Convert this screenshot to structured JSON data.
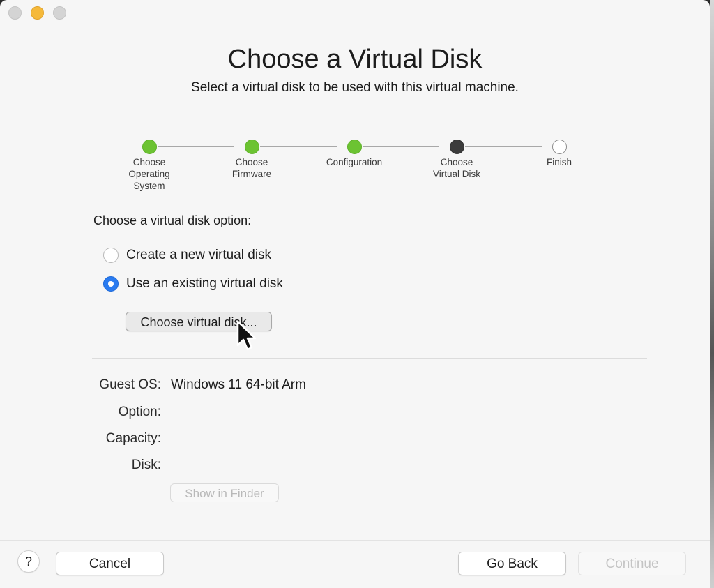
{
  "window": {
    "title": "Choose a Virtual Disk",
    "subtitle": "Select a virtual disk to be used with this virtual machine."
  },
  "stepper": {
    "steps": [
      {
        "label": "Choose\nOperating\nSystem",
        "state": "done"
      },
      {
        "label": "Choose\nFirmware",
        "state": "done"
      },
      {
        "label": "Configuration",
        "state": "done"
      },
      {
        "label": "Choose\nVirtual Disk",
        "state": "current"
      },
      {
        "label": "Finish",
        "state": "todo"
      }
    ]
  },
  "disk_options": {
    "heading": "Choose a virtual disk option:",
    "options": [
      {
        "label": "Create a new virtual disk",
        "selected": false
      },
      {
        "label": "Use an existing virtual disk",
        "selected": true
      }
    ],
    "choose_button": "Choose virtual disk..."
  },
  "summary": {
    "guest_os_label": "Guest OS:",
    "guest_os_value": "Windows 11 64-bit Arm",
    "option_label": "Option:",
    "option_value": "",
    "capacity_label": "Capacity:",
    "capacity_value": "",
    "disk_label": "Disk:",
    "disk_value": "",
    "show_in_finder": "Show in Finder"
  },
  "footer": {
    "help": "?",
    "cancel": "Cancel",
    "go_back": "Go Back",
    "continue": "Continue"
  },
  "colors": {
    "step_done": "#6cc332",
    "step_current": "#3c3c3c",
    "radio_selected": "#2a7bf0",
    "traffic_minimize": "#f5b93a"
  },
  "icons": [
    "close-button",
    "minimize-button",
    "zoom-button",
    "mouse-pointer-icon"
  ]
}
